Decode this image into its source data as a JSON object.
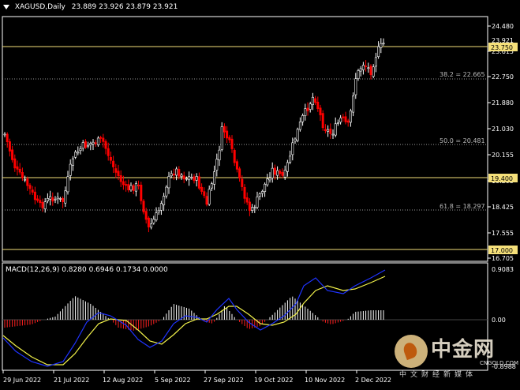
{
  "header": {
    "symbol_timeframe": "XAGUSD,Daily",
    "ohlc": "23.889 23.926 23.879 23.921"
  },
  "macd": {
    "title": "MACD(12,26,9) 0.8280 0.6946 0.1734 0.0000",
    "axis_labels": [
      "0.9083",
      "0.00",
      "-0.8988"
    ]
  },
  "price_axis": {
    "labels": [
      "24.480",
      "23.615",
      "22.750",
      "21.880",
      "21.030",
      "20.155",
      "19.295",
      "18.425",
      "17.555",
      "16.705"
    ],
    "current_price": "23.921",
    "level_boxes": [
      "23.750",
      "19.400",
      "17.000"
    ]
  },
  "fibonacci": [
    {
      "label": "38.2 = 22.665"
    },
    {
      "label": "50.0 = 20.481"
    },
    {
      "label": "61.8 = 18.297"
    }
  ],
  "time_axis": {
    "labels": [
      "29 Jun 2022",
      "21 Jul 2022",
      "12 Aug 2022",
      "5 Sep 2022",
      "27 Sep 2022",
      "19 Oct 2022",
      "10 Nov 2022",
      "2 Dec 2022"
    ]
  },
  "colors": {
    "background": "#000000",
    "bull_candle": "#ffffff",
    "bear_candle": "#ff0000",
    "level_line": "#f5e07a",
    "fib_line": "#9a9a9a",
    "macd_main": "#1f33ff",
    "macd_signal": "#f0f04a",
    "hist_pos": "#ffffff",
    "hist_neg": "#ff2020"
  },
  "watermark": {
    "brand": "中金网",
    "url": "CNGOLD.COM",
    "subtitle": "中文财经新媒体"
  }
}
